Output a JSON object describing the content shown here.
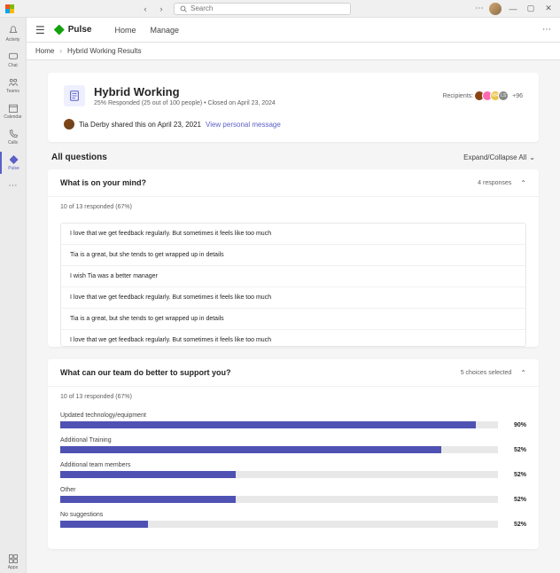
{
  "titlebar": {
    "search_placeholder": "Search"
  },
  "rail": {
    "items": [
      {
        "label": "Activity"
      },
      {
        "label": "Chat"
      },
      {
        "label": "Teams"
      },
      {
        "label": "Calendar"
      },
      {
        "label": "Calls"
      },
      {
        "label": "Pulse"
      }
    ],
    "apps_label": "Apps"
  },
  "app_header": {
    "brand": "Pulse",
    "nav": [
      "Home",
      "Manage"
    ]
  },
  "breadcrumb": {
    "items": [
      "Home",
      "Hybrid Working Results"
    ]
  },
  "survey": {
    "title": "Hybrid Working",
    "meta": "25% Responded (25 out of 100 people)   •   Closed on April 23, 2024",
    "recipients_label": "Recipients:",
    "badge1": "MR",
    "badge2": "LS",
    "badge3": "+96",
    "share_text": "Tia Derby shared this on April 23, 2021",
    "share_link": "View personal message"
  },
  "sections": {
    "all_questions": "All questions",
    "expand_collapse": "Expand/Collapse All"
  },
  "q1": {
    "title": "What is on your mind?",
    "meta": "4 responses",
    "sub": "10 of 13 responded (67%)",
    "responses": [
      "I love that we get feedback regularly. But sometimes it feels like too much",
      "Tia is a great, but she tends to get wrapped up in details",
      "I wish Tia was a better manager",
      "I love that we get feedback regularly. But sometimes it feels like too much",
      "Tia is a great, but she tends to get wrapped up in details",
      "I love that we get feedback regularly. But sometimes it feels like too much"
    ]
  },
  "q2": {
    "title": "What can our team do better to support you?",
    "meta": "5 choices selected",
    "sub": "10 of 13 responded (67%)"
  },
  "chart_data": {
    "type": "bar",
    "orientation": "horizontal",
    "categories": [
      "Updated technology/equipment",
      "Additional Training",
      "Additional team members",
      "Other",
      "No suggestions"
    ],
    "values": [
      90,
      52,
      52,
      52,
      52
    ],
    "display": [
      "90%",
      "52%",
      "52%",
      "52%",
      "52%"
    ],
    "fill_width_pct": [
      95,
      87,
      40,
      40,
      20
    ],
    "color": "#4f52b2",
    "xlim": [
      0,
      100
    ]
  }
}
